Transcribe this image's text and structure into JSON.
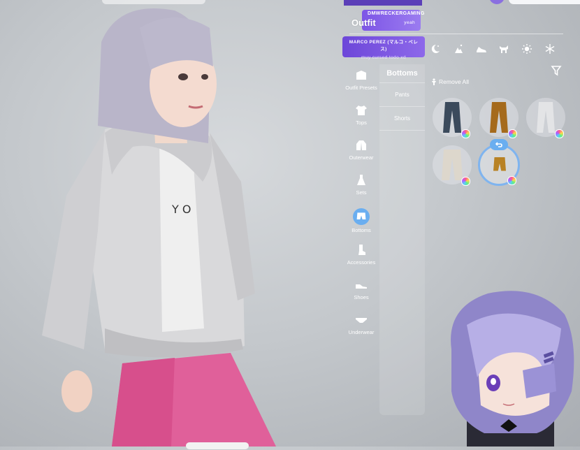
{
  "chat": {
    "messages": [
      {
        "user": "DMWRECKERGAMING",
        "text": "yeah"
      },
      {
        "user": "MARCO PEREZ (マルコ・ペレス)",
        "text": "muy cursed todo xd"
      }
    ]
  },
  "panel": {
    "title": "Outfit",
    "toolbar_icons": [
      "moon-star-icon",
      "sparkle-night-icon",
      "sneaker-icon",
      "animal-icon",
      "sun-icon",
      "snowflake-icon"
    ],
    "categories": [
      {
        "label": "Outfit Presets",
        "icon": "hanger-icon"
      },
      {
        "label": "Tops",
        "icon": "tshirt-icon"
      },
      {
        "label": "Outerwear",
        "icon": "jacket-icon"
      },
      {
        "label": "Sets",
        "icon": "dress-icon"
      },
      {
        "label": "Bottoms",
        "icon": "shorts-icon",
        "active": true
      },
      {
        "label": "Accessories",
        "icon": "sock-icon"
      },
      {
        "label": "Shoes",
        "icon": "shoe-icon"
      },
      {
        "label": "Underwear",
        "icon": "underwear-icon"
      }
    ],
    "subpanel": {
      "title": "Bottoms",
      "items": [
        "Pants",
        "Shorts"
      ]
    },
    "remove_all": "Remove All",
    "items": [
      {
        "name": "denim-jeans",
        "color": "#3b4a5c"
      },
      {
        "name": "tan-pants",
        "color": "#a56a1c"
      },
      {
        "name": "white-pants",
        "color": "#e3e4e6"
      },
      {
        "name": "cream-pants",
        "color": "#ddd7cc"
      },
      {
        "name": "tan-shorts",
        "color": "#b88224",
        "selected": true
      }
    ]
  }
}
